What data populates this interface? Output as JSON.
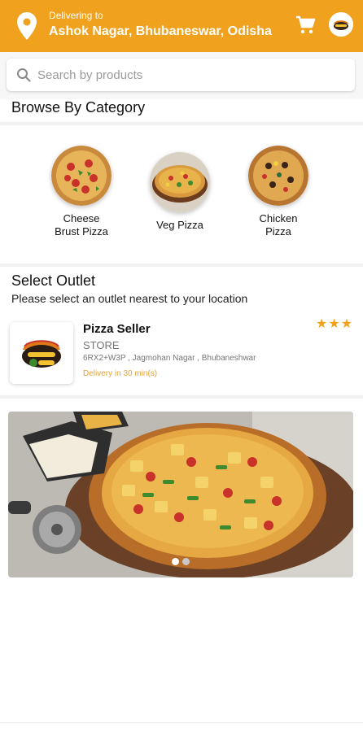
{
  "header": {
    "delivering_label": "Delivering to",
    "address": "Ashok Nagar, Bhubaneswar, Odisha",
    "brand_color": "#f0a21f"
  },
  "search": {
    "placeholder": "Search by products"
  },
  "categories": {
    "title": "Browse By Category",
    "items": [
      {
        "label": "Cheese\nBrust Pizza",
        "icon": "pizza-image"
      },
      {
        "label": "Veg Pizza",
        "icon": "pizza-image"
      },
      {
        "label": "Chicken\nPizza",
        "icon": "pizza-image"
      }
    ]
  },
  "outlet": {
    "title": "Select Outlet",
    "subtitle": "Please select an outlet nearest to your location",
    "card": {
      "name": "Pizza Seller",
      "type": "STORE",
      "address": "6RX2+W3P , Jagmohan Nagar , Bhubaneshwar",
      "eta": "Delivery in 30 min(s)",
      "rating": 3,
      "stars": "★★★"
    }
  },
  "banner": {
    "slides": 2,
    "active": 0
  }
}
